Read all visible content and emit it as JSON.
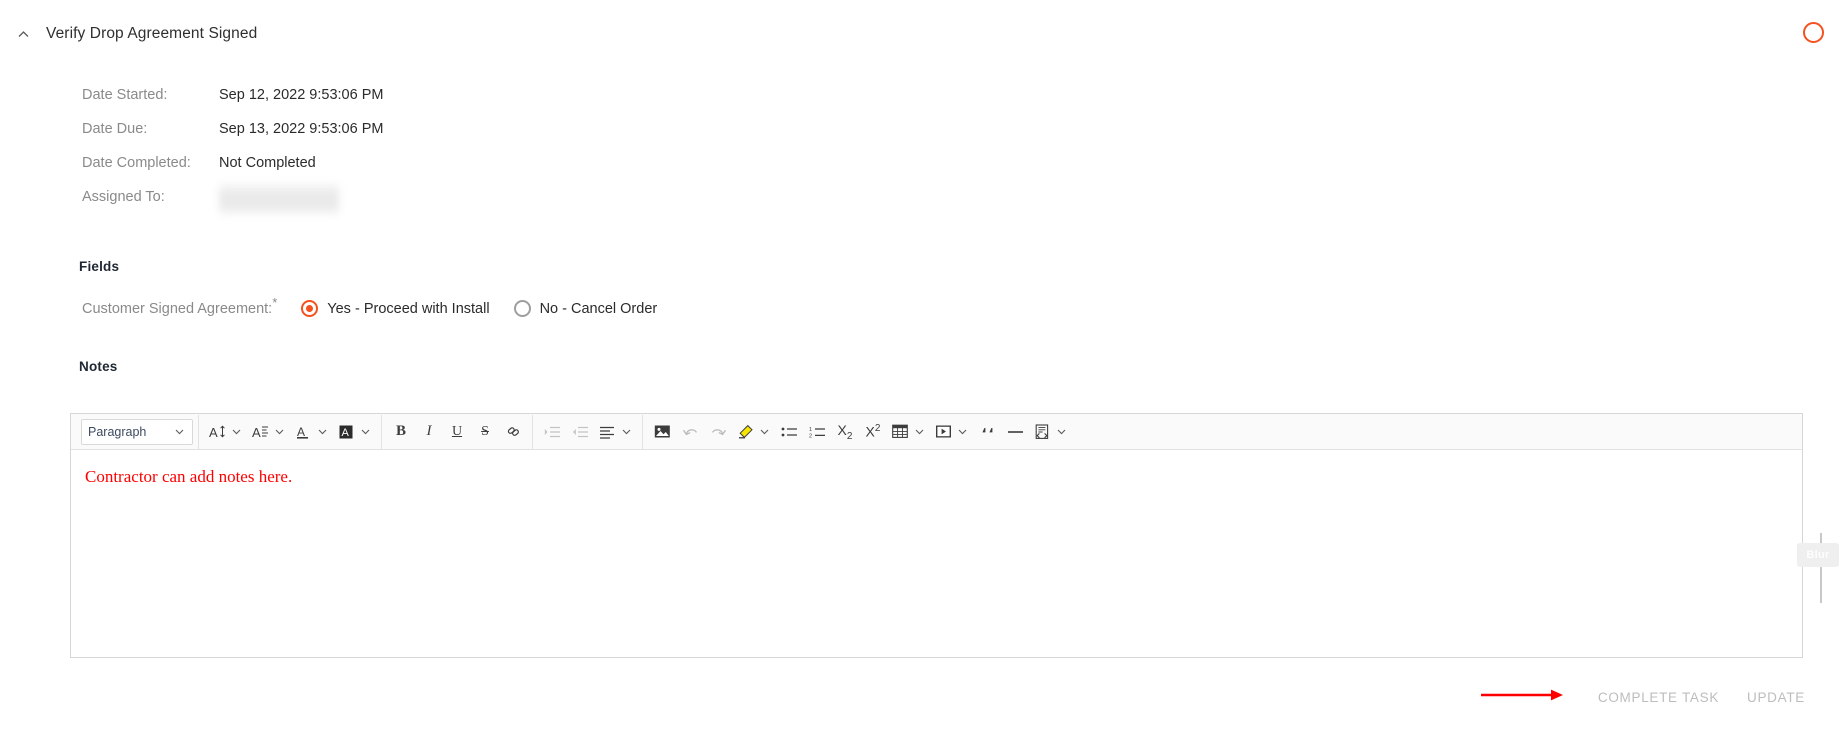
{
  "header": {
    "title": "Verify Drop Agreement Signed",
    "collapse_icon": "chevron-up-icon",
    "status_icon": "status-circle-icon",
    "status_color": "#f4511e"
  },
  "meta": {
    "rows": [
      {
        "label": "Date Started:",
        "value": "Sep 12, 2022 9:53:06 PM",
        "redacted": false
      },
      {
        "label": "Date Due:",
        "value": "Sep 13, 2022 9:53:06 PM",
        "redacted": false
      },
      {
        "label": "Date Completed:",
        "value": "Not Completed",
        "redacted": false
      },
      {
        "label": "Assigned To:",
        "value": "",
        "redacted": true
      }
    ]
  },
  "fields": {
    "section_label": "Fields",
    "field_label": "Customer Signed Agreement:",
    "required_marker": "*",
    "options": [
      {
        "label": "Yes - Proceed with Install",
        "selected": true
      },
      {
        "label": "No - Cancel Order",
        "selected": false
      }
    ]
  },
  "notes": {
    "section_label": "Notes",
    "body_text": "Contractor can add notes here.",
    "body_text_color": "#ff0000",
    "toolbar": {
      "paragraph_style": "Paragraph",
      "items": [
        {
          "name": "font-size-icon",
          "glyph": "A↕",
          "caret": true,
          "disabled": false
        },
        {
          "name": "line-height-icon",
          "glyph": "A≡",
          "caret": true,
          "disabled": false
        },
        {
          "name": "font-color-icon",
          "glyph": "A",
          "caret": true,
          "disabled": false
        },
        {
          "name": "text-background-color-icon",
          "glyph": "A",
          "caret": true,
          "disabled": false
        },
        {
          "name": "bold-icon",
          "glyph": "B",
          "caret": false,
          "disabled": false
        },
        {
          "name": "italic-icon",
          "glyph": "I",
          "caret": false,
          "disabled": false
        },
        {
          "name": "underline-icon",
          "glyph": "U",
          "caret": false,
          "disabled": false
        },
        {
          "name": "strikethrough-icon",
          "glyph": "S",
          "caret": false,
          "disabled": false
        },
        {
          "name": "link-icon",
          "glyph": "℗",
          "caret": false,
          "disabled": false
        },
        {
          "name": "indent-icon",
          "glyph": "",
          "caret": false,
          "disabled": true
        },
        {
          "name": "outdent-icon",
          "glyph": "",
          "caret": false,
          "disabled": true
        },
        {
          "name": "align-icon",
          "glyph": "",
          "caret": true,
          "disabled": false
        },
        {
          "name": "insert-image-icon",
          "glyph": "",
          "caret": false,
          "disabled": false
        },
        {
          "name": "undo-icon",
          "glyph": "↶",
          "caret": false,
          "disabled": true
        },
        {
          "name": "redo-icon",
          "glyph": "↷",
          "caret": false,
          "disabled": true
        },
        {
          "name": "highlighter-icon",
          "glyph": "",
          "caret": true,
          "disabled": false
        },
        {
          "name": "bulleted-list-icon",
          "glyph": "",
          "caret": false,
          "disabled": false
        },
        {
          "name": "numbered-list-icon",
          "glyph": "",
          "caret": false,
          "disabled": false
        },
        {
          "name": "subscript-icon",
          "glyph": "X₂",
          "caret": false,
          "disabled": false
        },
        {
          "name": "superscript-icon",
          "glyph": "X²",
          "caret": false,
          "disabled": false
        },
        {
          "name": "insert-table-icon",
          "glyph": "",
          "caret": true,
          "disabled": false
        },
        {
          "name": "insert-media-icon",
          "glyph": "",
          "caret": true,
          "disabled": false
        },
        {
          "name": "blockquote-icon",
          "glyph": "“",
          "caret": false,
          "disabled": false
        },
        {
          "name": "horizontal-rule-icon",
          "glyph": "—",
          "caret": false,
          "disabled": false
        },
        {
          "name": "source-code-icon",
          "glyph": "",
          "caret": true,
          "disabled": false
        }
      ]
    }
  },
  "footer": {
    "complete_task_label": "COMPLETE TASK",
    "update_label": "UPDATE",
    "annotation_icon": "red-arrow-annotation",
    "annotation_color": "#ff0000"
  },
  "overlay": {
    "blur_tool_label": "Blur"
  }
}
